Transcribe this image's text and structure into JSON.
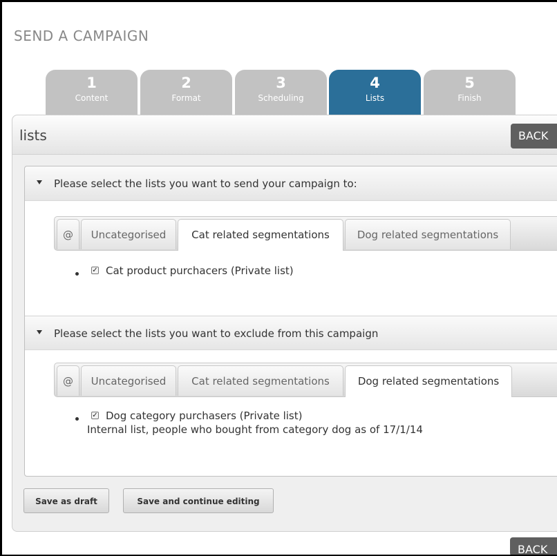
{
  "page": {
    "title": "SEND A CAMPAIGN"
  },
  "steps": [
    {
      "num": "1",
      "label": "Content"
    },
    {
      "num": "2",
      "label": "Format"
    },
    {
      "num": "3",
      "label": "Scheduling"
    },
    {
      "num": "4",
      "label": "Lists",
      "active": true
    },
    {
      "num": "5",
      "label": "Finish"
    }
  ],
  "panel": {
    "title": "lists",
    "back_label": "BACK"
  },
  "include_section": {
    "heading": "Please select the lists you want to send your campaign to:",
    "tabs": [
      "@",
      "Uncategorised",
      "Cat related segmentations",
      "Dog related segmentations"
    ],
    "active_tab": "Cat related segmentations",
    "items": [
      {
        "label": "Cat product purchacers (Private list)",
        "checked": true
      }
    ]
  },
  "exclude_section": {
    "heading": "Please select the lists you want to exclude from this campaign",
    "tabs": [
      "@",
      "Uncategorised",
      "Cat related segmentations",
      "Dog related segmentations"
    ],
    "active_tab": "Dog related segmentations",
    "items": [
      {
        "label": "Dog category purchasers (Private list)",
        "description": "Internal list, people who bought from category dog as of 17/1/14",
        "checked": true
      }
    ]
  },
  "actions": {
    "save_draft": "Save as draft",
    "save_continue": "Save and continue editing"
  },
  "footer": {
    "back_label": "BACK"
  },
  "colors": {
    "active_step": "#2b6f99",
    "inactive_step": "#c2c2c2",
    "back_button": "#5f5f5f"
  }
}
